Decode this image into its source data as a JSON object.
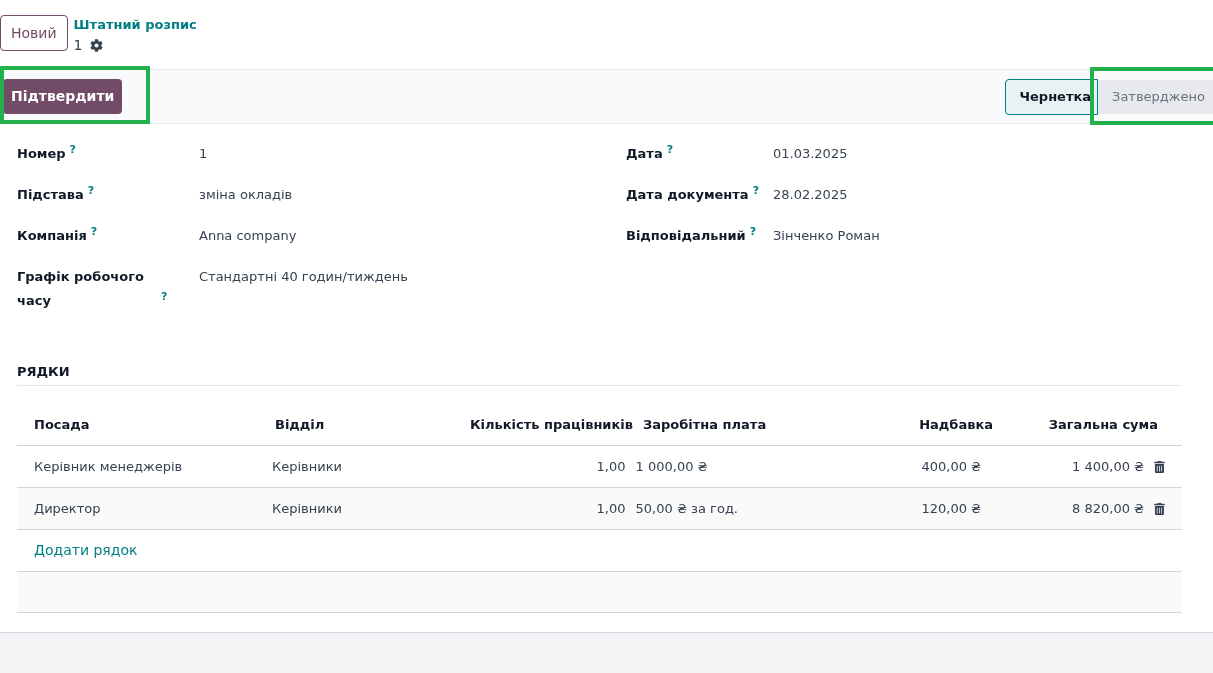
{
  "header": {
    "new_button": "Новий",
    "breadcrumb": "Штатний розпис",
    "record": "1"
  },
  "actions": [
    {
      "label": "Підтвердити",
      "highlighted": true
    }
  ],
  "status_steps": [
    {
      "label": "Чернетка",
      "selected": true,
      "highlighted": false
    },
    {
      "label": "Затверджено",
      "selected": false,
      "highlighted": true
    }
  ],
  "fields_left": [
    {
      "label": "Номер",
      "help": "?",
      "value": "1"
    },
    {
      "label": "Підстава",
      "help": "?",
      "value": "зміна окладів"
    },
    {
      "label": "Компанія",
      "help": "?",
      "value": "Anna company"
    },
    {
      "label": "Графік робочого часу",
      "help": "?",
      "value": "Стандартні 40 годин/тиждень"
    }
  ],
  "fields_right": [
    {
      "label": "Дата",
      "help": "?",
      "value": "01.03.2025"
    },
    {
      "label": "Дата документа",
      "help": "?",
      "value": "28.02.2025"
    },
    {
      "label": "Відповідальний",
      "help": "?",
      "value": "Зінченко Роман"
    }
  ],
  "section_title": "РЯДКИ",
  "table": {
    "columns": [
      "Посада",
      "Відділ",
      "Кількість працівників",
      "Заробітна плата",
      "Надбавка",
      "Загальна сума"
    ],
    "rows": [
      [
        "Керівник менеджерів",
        "Керівники",
        "1,00",
        "1 000,00 ₴",
        "400,00 ₴",
        "1 400,00 ₴"
      ],
      [
        "Директор",
        "Керівники",
        "1,00",
        "50,00 ₴ за год.",
        "120,00 ₴",
        "8 820,00 ₴"
      ]
    ],
    "add_line": "Додати рядок"
  }
}
